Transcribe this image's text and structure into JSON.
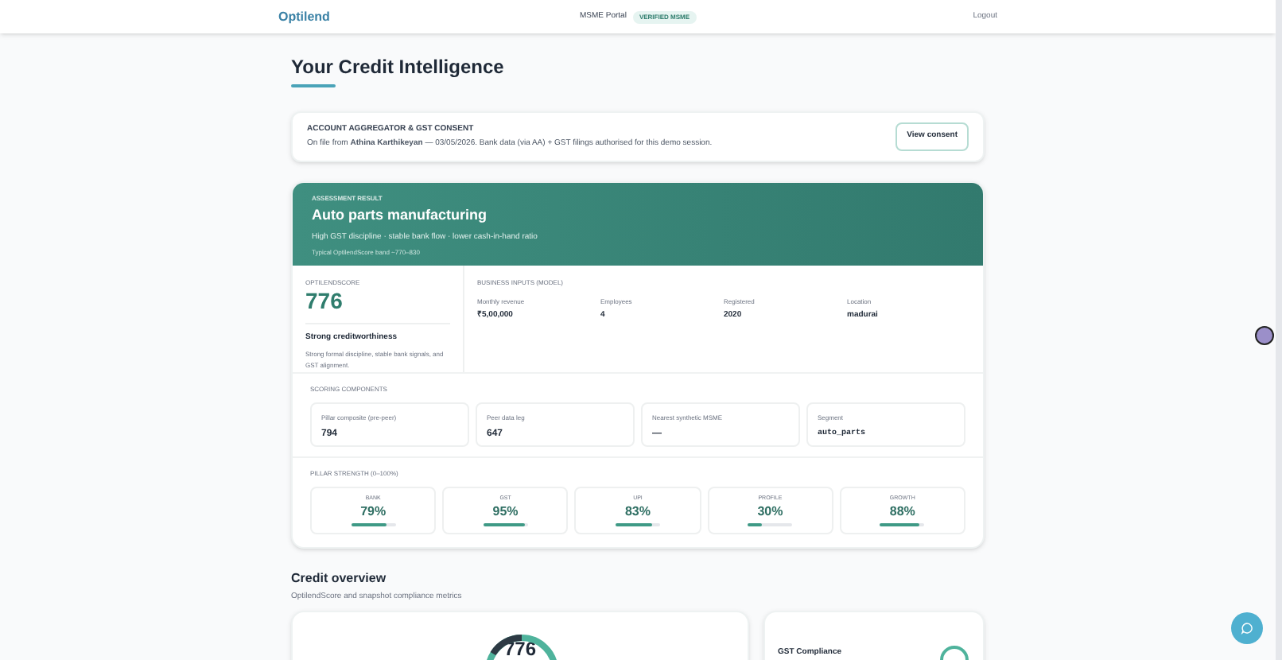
{
  "header": {
    "logo": "Optilend",
    "portal": "MSME Portal",
    "badge": "VERIFIED MSME",
    "logout": "Logout"
  },
  "title": "Your Credit Intelligence",
  "consent": {
    "heading": "ACCOUNT AGGREGATOR & GST CONSENT",
    "text": "On file from **Athina Karthikeyan** — 03/05/2026. Bank data (via AA) + GST filings authorised for this demo session.",
    "button": "View consent"
  },
  "assessment": {
    "label": "ASSESSMENT RESULT",
    "title": "Auto parts manufacturing",
    "subtitle": "High GST discipline · stable bank flow · lower cash-in-hand ratio",
    "band": "Typical OptilendScore band ~770–830"
  },
  "score": {
    "label": "OPTILENDSCORE",
    "value": "776",
    "verdict": "Strong creditworthiness",
    "note": "Strong formal discipline, stable bank signals, and GST alignment."
  },
  "inputs": {
    "label": "BUSINESS INPUTS (MODEL)",
    "items": [
      {
        "label": "Monthly revenue",
        "value": "₹5,00,000"
      },
      {
        "label": "Employees",
        "value": "4"
      },
      {
        "label": "Registered",
        "value": "2020"
      },
      {
        "label": "Location",
        "value": "madurai"
      }
    ]
  },
  "components": {
    "label": "SCORING COMPONENTS",
    "items": [
      {
        "label": "Pillar composite (pre-peer)",
        "value": "794",
        "kind": "text"
      },
      {
        "label": "Peer data leg",
        "value": "647",
        "kind": "text"
      },
      {
        "label": "Nearest synthetic MSME",
        "value": "—",
        "kind": "text"
      },
      {
        "label": "Segment",
        "value": "auto_parts",
        "kind": "code"
      }
    ]
  },
  "pillars": {
    "label": "PILLAR STRENGTH (0–100%)",
    "items": [
      {
        "name": "BANK",
        "reading": "79%",
        "level": 0.79
      },
      {
        "name": "GST",
        "reading": "95%",
        "level": 0.95
      },
      {
        "name": "UPI",
        "reading": "83%",
        "level": 0.83
      },
      {
        "name": "PROFILE",
        "reading": "30%",
        "level": 0.3
      },
      {
        "name": "GROWTH",
        "reading": "88%",
        "level": 0.88
      }
    ]
  },
  "overview": {
    "title": "Credit overview",
    "subtitle": "OptilendScore and snapshot compliance metrics",
    "score": "776",
    "gst_label": "GST Compliance"
  }
}
